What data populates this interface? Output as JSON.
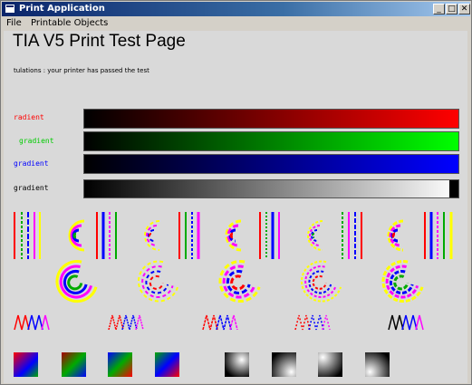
{
  "window": {
    "title": "Print Application",
    "controls": {
      "minimize": "_",
      "maximize": "□",
      "close": "✕"
    }
  },
  "menu": {
    "items": [
      "File",
      "Printable Objects"
    ]
  },
  "page": {
    "title": "TIA V5 Print Test Page",
    "status": "tulations : your printer has passed the test"
  },
  "gradients": [
    {
      "label": "radient",
      "color": "#ff0000"
    },
    {
      "label": "gradient",
      "color": "#00cc00"
    },
    {
      "label": "gradient",
      "color": "#0000ff"
    },
    {
      "label": "gradient",
      "color": "#000000"
    }
  ],
  "colors": {
    "red": "#ff0000",
    "green": "#00ff00",
    "blue": "#0000ff",
    "magenta": "#ff00ff",
    "yellow": "#ffff00",
    "cyan": "#00ffff"
  }
}
